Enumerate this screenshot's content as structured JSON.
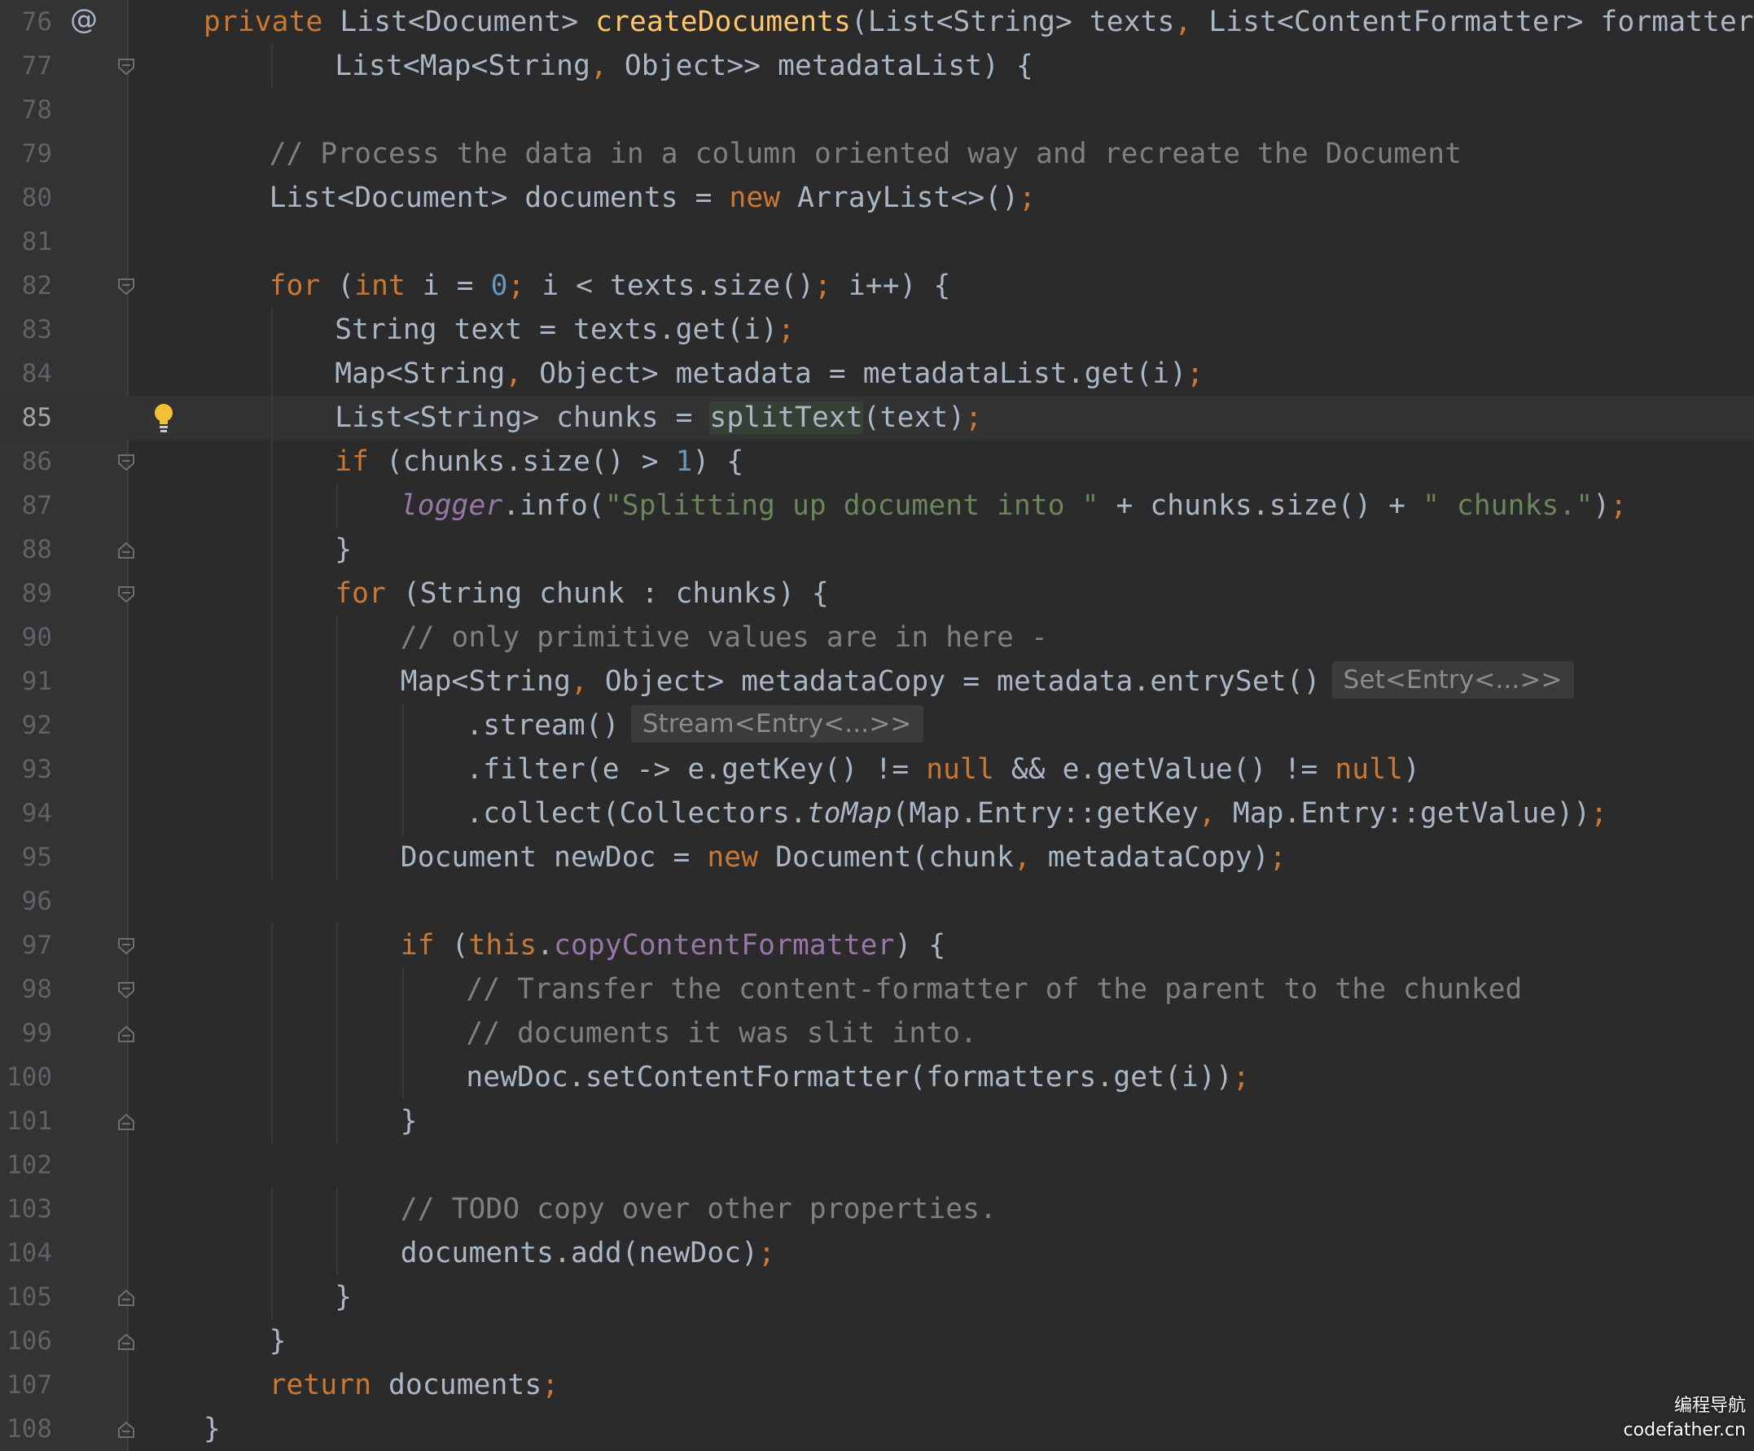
{
  "editor": {
    "lines": [
      {
        "n": "76",
        "current": false,
        "gutter": "at",
        "indent": 1,
        "tokens": [
          [
            "kw",
            "private "
          ],
          [
            "",
            "List<Document> "
          ],
          [
            "fn",
            "createDocuments"
          ],
          [
            "",
            "(List<String> texts"
          ],
          [
            "kw",
            ", "
          ],
          [
            "",
            "List<ContentFormatter> formatters"
          ],
          [
            "kw",
            ","
          ]
        ]
      },
      {
        "n": "77",
        "current": false,
        "gutter": "fold-open",
        "indent": 3,
        "tokens": [
          [
            "",
            "List<Map<String"
          ],
          [
            "kw",
            ", "
          ],
          [
            "",
            "Object>> metadataList) {"
          ]
        ]
      },
      {
        "n": "78",
        "current": false,
        "indent": 0,
        "tokens": []
      },
      {
        "n": "79",
        "current": false,
        "indent": 2,
        "tokens": [
          [
            "cm",
            "// Process the data in a column oriented way and recreate the Document"
          ]
        ]
      },
      {
        "n": "80",
        "current": false,
        "indent": 2,
        "tokens": [
          [
            "",
            "List<Document> documents = "
          ],
          [
            "kw",
            "new "
          ],
          [
            "",
            "ArrayList<>()"
          ],
          [
            "kw",
            ";"
          ]
        ]
      },
      {
        "n": "81",
        "current": false,
        "indent": 0,
        "tokens": []
      },
      {
        "n": "82",
        "current": false,
        "gutter": "fold-open",
        "indent": 2,
        "tokens": [
          [
            "kw",
            "for "
          ],
          [
            "",
            "("
          ],
          [
            "kw",
            "int "
          ],
          [
            "",
            "i = "
          ],
          [
            "num",
            "0"
          ],
          [
            "kw",
            "; "
          ],
          [
            "",
            "i < texts.size()"
          ],
          [
            "kw",
            "; "
          ],
          [
            "",
            "i++) {"
          ]
        ]
      },
      {
        "n": "83",
        "current": false,
        "indent": 3,
        "tokens": [
          [
            "",
            "String text = texts.get(i)"
          ],
          [
            "kw",
            ";"
          ]
        ]
      },
      {
        "n": "84",
        "current": false,
        "indent": 3,
        "tokens": [
          [
            "",
            "Map<String"
          ],
          [
            "kw",
            ", "
          ],
          [
            "",
            "Object> metadata = metadataList.get(i)"
          ],
          [
            "kw",
            ";"
          ]
        ]
      },
      {
        "n": "85",
        "current": true,
        "gutter": "bulb",
        "indent": 3,
        "tokens": [
          [
            "",
            "List<String> chunks = "
          ],
          [
            "hl",
            "splitText"
          ],
          [
            "",
            "(text)"
          ],
          [
            "kw",
            ";"
          ]
        ]
      },
      {
        "n": "86",
        "current": false,
        "gutter": "fold-open",
        "indent": 3,
        "tokens": [
          [
            "kw",
            "if "
          ],
          [
            "",
            "(chunks.size() > "
          ],
          [
            "num",
            "1"
          ],
          [
            "",
            ") {"
          ]
        ]
      },
      {
        "n": "87",
        "current": false,
        "indent": 4,
        "tokens": [
          [
            "fld ital",
            "logger"
          ],
          [
            "",
            ".info("
          ],
          [
            "str",
            "\"Splitting up document into \""
          ],
          [
            "",
            " + chunks.size() + "
          ],
          [
            "str",
            "\" chunks.\""
          ],
          [
            "",
            ")"
          ],
          [
            "kw",
            ";"
          ]
        ]
      },
      {
        "n": "88",
        "current": false,
        "gutter": "fold-close",
        "indent": 3,
        "tokens": [
          [
            "",
            "}"
          ]
        ]
      },
      {
        "n": "89",
        "current": false,
        "gutter": "fold-open",
        "indent": 3,
        "tokens": [
          [
            "kw",
            "for "
          ],
          [
            "",
            "(String chunk : chunks) {"
          ]
        ]
      },
      {
        "n": "90",
        "current": false,
        "indent": 4,
        "tokens": [
          [
            "cm",
            "// only primitive values are in here -"
          ]
        ]
      },
      {
        "n": "91",
        "current": false,
        "indent": 4,
        "tokens": [
          [
            "",
            "Map<String"
          ],
          [
            "kw",
            ", "
          ],
          [
            "",
            "Object> metadataCopy = metadata.entrySet()"
          ],
          [
            "hint",
            "Set<Entry<...>>"
          ]
        ]
      },
      {
        "n": "92",
        "current": false,
        "indent": 5,
        "tokens": [
          [
            "",
            ".stream()"
          ],
          [
            "hint",
            "Stream<Entry<...>>"
          ]
        ]
      },
      {
        "n": "93",
        "current": false,
        "indent": 5,
        "tokens": [
          [
            "",
            ".filter(e -> e.getKey() != "
          ],
          [
            "kw",
            "null "
          ],
          [
            "",
            "&& e.getValue() != "
          ],
          [
            "kw",
            "null"
          ],
          [
            "",
            ")"
          ]
        ]
      },
      {
        "n": "94",
        "current": false,
        "indent": 5,
        "tokens": [
          [
            "",
            ".collect(Collectors."
          ],
          [
            "ital",
            "toMap"
          ],
          [
            "",
            "(Map.Entry::getKey"
          ],
          [
            "kw",
            ", "
          ],
          [
            "",
            "Map.Entry::getValue))"
          ],
          [
            "kw",
            ";"
          ]
        ]
      },
      {
        "n": "95",
        "current": false,
        "indent": 4,
        "tokens": [
          [
            "",
            "Document newDoc = "
          ],
          [
            "kw",
            "new "
          ],
          [
            "",
            "Document(chunk"
          ],
          [
            "kw",
            ", "
          ],
          [
            "",
            "metadataCopy)"
          ],
          [
            "kw",
            ";"
          ]
        ]
      },
      {
        "n": "96",
        "current": false,
        "indent": 0,
        "tokens": []
      },
      {
        "n": "97",
        "current": false,
        "gutter": "fold-open",
        "indent": 4,
        "tokens": [
          [
            "kw",
            "if "
          ],
          [
            "",
            "("
          ],
          [
            "kw",
            "this"
          ],
          [
            "",
            "."
          ],
          [
            "fld",
            "copyContentFormatter"
          ],
          [
            "",
            ") {"
          ]
        ]
      },
      {
        "n": "98",
        "current": false,
        "gutter": "fold-open",
        "indent": 5,
        "tokens": [
          [
            "cm",
            "// Transfer the content-formatter of the parent to the chunked"
          ]
        ]
      },
      {
        "n": "99",
        "current": false,
        "gutter": "fold-close",
        "indent": 5,
        "tokens": [
          [
            "cm",
            "// documents it was slit into."
          ]
        ]
      },
      {
        "n": "100",
        "current": false,
        "indent": 5,
        "tokens": [
          [
            "",
            "newDoc.setContentFormatter(formatters.get(i))"
          ],
          [
            "kw",
            ";"
          ]
        ]
      },
      {
        "n": "101",
        "current": false,
        "gutter": "fold-close",
        "indent": 4,
        "tokens": [
          [
            "",
            "}"
          ]
        ]
      },
      {
        "n": "102",
        "current": false,
        "indent": 0,
        "tokens": []
      },
      {
        "n": "103",
        "current": false,
        "indent": 4,
        "tokens": [
          [
            "cm",
            "// TODO copy over other properties."
          ]
        ]
      },
      {
        "n": "104",
        "current": false,
        "indent": 4,
        "tokens": [
          [
            "",
            "documents.add(newDoc)"
          ],
          [
            "kw",
            ";"
          ]
        ]
      },
      {
        "n": "105",
        "current": false,
        "gutter": "fold-close",
        "indent": 3,
        "tokens": [
          [
            "",
            "}"
          ]
        ]
      },
      {
        "n": "106",
        "current": false,
        "gutter": "fold-close",
        "indent": 2,
        "tokens": [
          [
            "",
            "}"
          ]
        ]
      },
      {
        "n": "107",
        "current": false,
        "indent": 2,
        "tokens": [
          [
            "kw",
            "return "
          ],
          [
            "",
            "documents"
          ],
          [
            "kw",
            ";"
          ]
        ]
      },
      {
        "n": "108",
        "current": false,
        "gutter": "fold-close",
        "indent": 1,
        "tokens": [
          [
            "",
            "}"
          ]
        ]
      }
    ]
  },
  "gutter_icons": {
    "at": "override-at-icon",
    "bulb": "lightbulb-icon",
    "fold-open": "fold-collapse-icon",
    "fold-close": "fold-end-icon"
  },
  "colors": {
    "background": "#2b2b2b",
    "gutter": "#313335",
    "keyword": "#cc7832",
    "method_decl": "#ffc66d",
    "comment": "#808080",
    "number": "#6897bb",
    "string": "#6a8759",
    "field": "#9876aa",
    "text": "#a9b7c6"
  },
  "watermark": {
    "line1": "编程导航",
    "line2": "codefather.cn"
  }
}
